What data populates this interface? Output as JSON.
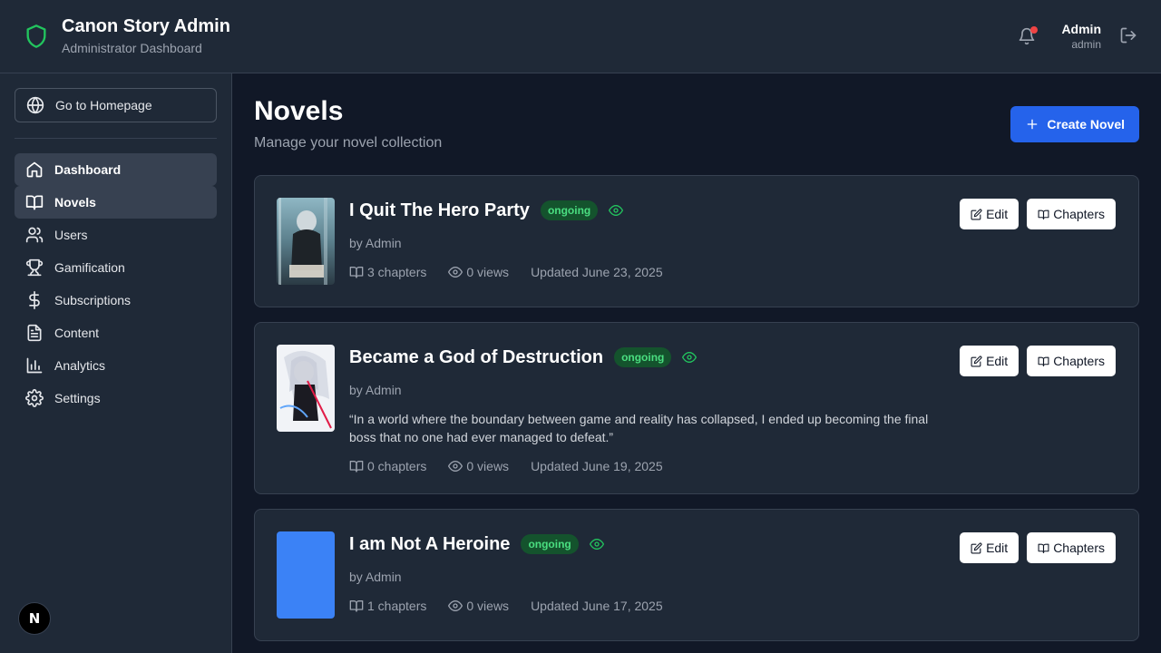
{
  "header": {
    "title": "Canon Story Admin",
    "subtitle": "Administrator Dashboard",
    "user_name": "Admin",
    "user_role": "admin",
    "brand_color": "#22c55e"
  },
  "sidebar": {
    "home_label": "Go to Homepage",
    "items": [
      {
        "label": "Dashboard",
        "icon": "home-icon"
      },
      {
        "label": "Novels",
        "icon": "book-open-icon"
      },
      {
        "label": "Users",
        "icon": "users-icon"
      },
      {
        "label": "Gamification",
        "icon": "trophy-icon"
      },
      {
        "label": "Subscriptions",
        "icon": "dollar-icon"
      },
      {
        "label": "Content",
        "icon": "file-text-icon"
      },
      {
        "label": "Analytics",
        "icon": "bar-chart-icon"
      },
      {
        "label": "Settings",
        "icon": "gear-icon"
      }
    ],
    "badge": "N"
  },
  "main": {
    "title": "Novels",
    "subtitle": "Manage your novel collection",
    "create_label": "Create Novel",
    "accent": "#2563eb"
  },
  "novels": [
    {
      "title": "I Quit The Hero Party",
      "status": "ongoing",
      "author": "by Admin",
      "description": "",
      "chapters": "3 chapters",
      "views": "0 views",
      "updated": "Updated June 23, 2025",
      "edit_label": "Edit",
      "chapters_label": "Chapters"
    },
    {
      "title": "Became a God of Destruction",
      "status": "ongoing",
      "author": "by Admin",
      "description": "“In a world where the boundary between game and reality has collapsed, I ended up becoming the final boss that no one had ever managed to defeat.”",
      "chapters": "0 chapters",
      "views": "0 views",
      "updated": "Updated June 19, 2025",
      "edit_label": "Edit",
      "chapters_label": "Chapters"
    },
    {
      "title": "I am Not A Heroine",
      "status": "ongoing",
      "author": "by Admin",
      "description": "",
      "chapters": "1 chapters",
      "views": "0 views",
      "updated": "Updated June 17, 2025",
      "edit_label": "Edit",
      "chapters_label": "Chapters"
    }
  ]
}
